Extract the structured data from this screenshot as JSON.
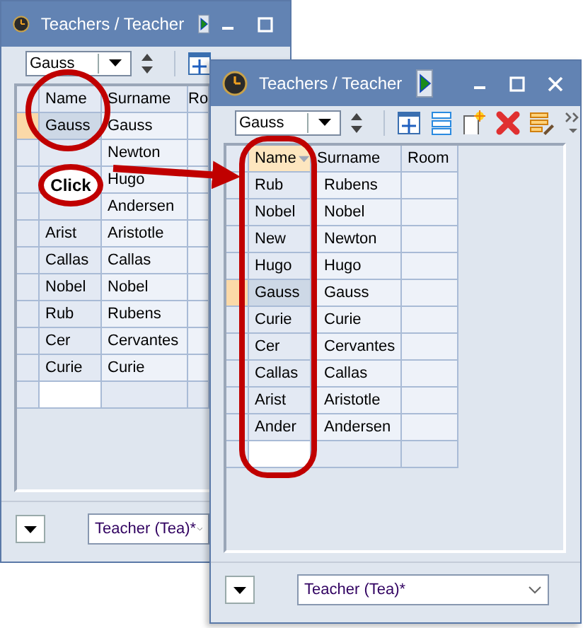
{
  "windows": [
    {
      "title": "Teachers / Teacher",
      "combo": {
        "value": "Gauss"
      },
      "tools": [
        {
          "kind": "grid"
        }
      ],
      "columns": [
        {
          "label": "Name",
          "sorted": false
        },
        {
          "label": "Surname",
          "sorted": false
        },
        {
          "label": "Ro",
          "sorted": false
        }
      ],
      "rows": [
        {
          "name": "Gauss",
          "surname": "Gauss",
          "selected": true
        },
        {
          "surname": "Newton",
          "selected": false
        },
        {
          "surname": "Hugo",
          "selected": false
        },
        {
          "surname": "Andersen",
          "selected": false
        },
        {
          "name": "Arist",
          "surname": "Aristotle",
          "selected": false
        },
        {
          "name": "Callas",
          "surname": "Callas",
          "selected": false
        },
        {
          "name": "Nobel",
          "surname": "Nobel",
          "selected": false
        },
        {
          "name": "Rub",
          "surname": "Rubens",
          "selected": false
        },
        {
          "name": "Cer",
          "surname": "Cervantes",
          "selected": false
        },
        {
          "name": "Curie",
          "surname": "Curie",
          "selected": false
        }
      ],
      "footer": {
        "value": "Teacher (Tea)*"
      }
    },
    {
      "title": "Teachers / Teacher",
      "combo": {
        "value": "Gauss"
      },
      "tools": [
        {
          "kind": "grid"
        },
        {
          "kind": "rows"
        },
        {
          "kind": "new"
        },
        {
          "kind": "delete"
        },
        {
          "kind": "edit"
        }
      ],
      "columns": [
        {
          "label": "Name",
          "sorted": true
        },
        {
          "label": "Surname",
          "sorted": false
        },
        {
          "label": "Room",
          "sorted": false
        }
      ],
      "rows": [
        {
          "name": "Rub",
          "surname": "Rubens",
          "selected": false
        },
        {
          "name": "Nobel",
          "surname": "Nobel",
          "selected": false
        },
        {
          "name": "New",
          "surname": "Newton",
          "selected": false
        },
        {
          "name": "Hugo",
          "surname": "Hugo",
          "selected": false
        },
        {
          "name": "Gauss",
          "surname": "Gauss",
          "selected": true
        },
        {
          "name": "Curie",
          "surname": "Curie",
          "selected": false
        },
        {
          "name": "Cer",
          "surname": "Cervantes",
          "selected": false
        },
        {
          "name": "Callas",
          "surname": "Callas",
          "selected": false
        },
        {
          "name": "Arist",
          "surname": "Aristotle",
          "selected": false
        },
        {
          "name": "Ander",
          "surname": "Andersen",
          "selected": false
        }
      ],
      "footer": {
        "value": "Teacher (Tea)*"
      }
    }
  ],
  "callout": {
    "label": "Click"
  }
}
